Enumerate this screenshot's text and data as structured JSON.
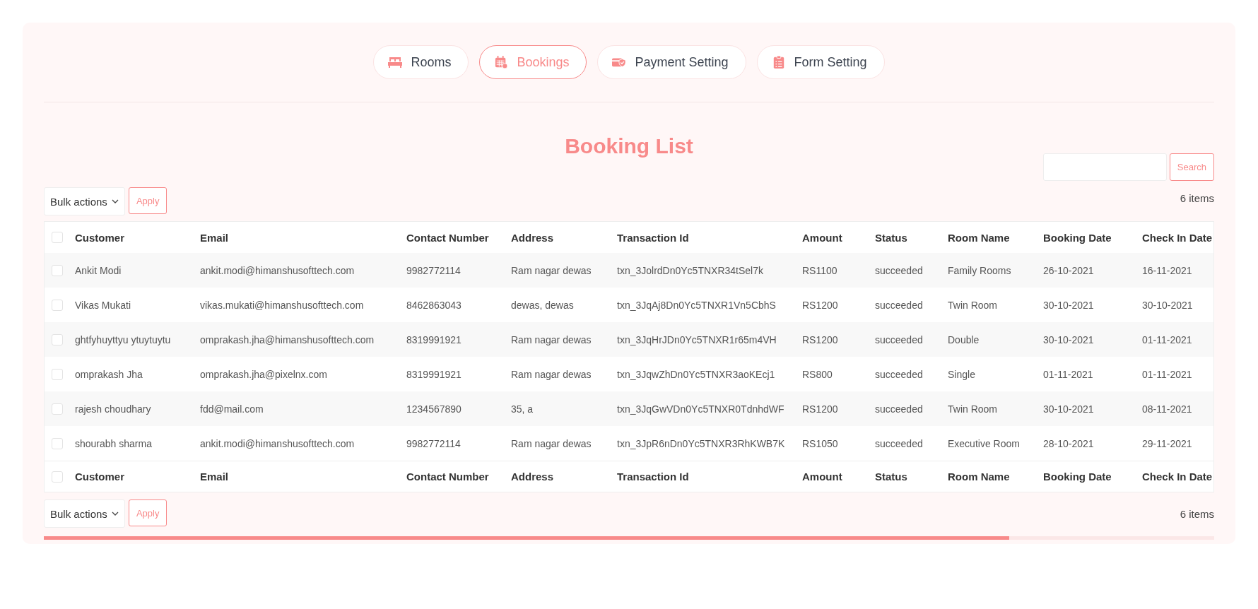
{
  "tabs": [
    {
      "label": "Rooms",
      "selected": false
    },
    {
      "label": "Bookings",
      "selected": true
    },
    {
      "label": "Payment Setting",
      "selected": false
    },
    {
      "label": "Form Setting",
      "selected": false
    }
  ],
  "title": "Booking List",
  "search": {
    "button": "Search"
  },
  "top_actions": {
    "bulk": "Bulk actions",
    "apply": "Apply",
    "count": "6 items"
  },
  "table": {
    "header_checked": false,
    "columns": [
      "Customer",
      "Email",
      "Contact Number",
      "Address",
      "Transaction Id",
      "Amount",
      "Status",
      "Room Name",
      "Booking Date",
      "Check In Date"
    ],
    "rows": [
      {
        "checked": false,
        "cells": [
          "Ankit Modi",
          "ankit.modi@himanshusofttech.com",
          "9982772114",
          "Ram nagar dewas",
          "txn_3JolrdDn0Yc5TNXR34tSel7k",
          "RS1100",
          "succeeded",
          "Family Rooms",
          "26-10-2021",
          "16-11-2021"
        ]
      },
      {
        "checked": false,
        "cells": [
          "Vikas Mukati",
          "vikas.mukati@himanshusofttech.com",
          "8462863043",
          "dewas, dewas",
          "txn_3JqAj8Dn0Yc5TNXR1Vn5CbhS",
          "RS1200",
          "succeeded",
          "Twin Room",
          "30-10-2021",
          "30-10-2021"
        ]
      },
      {
        "checked": false,
        "cells": [
          "ghtfyhuyttyu ytuytuytu",
          "omprakash.jha@himanshusofttech.com",
          "8319991921",
          "Ram nagar dewas",
          "txn_3JqHrJDn0Yc5TNXR1r65m4VH",
          "RS1200",
          "succeeded",
          "Double",
          "30-10-2021",
          "01-11-2021"
        ]
      },
      {
        "checked": false,
        "cells": [
          "omprakash Jha",
          "omprakash.jha@pixelnx.com",
          "8319991921",
          "Ram nagar dewas",
          "txn_3JqwZhDn0Yc5TNXR3aoKEcj1",
          "RS800",
          "succeeded",
          "Single",
          "01-11-2021",
          "01-11-2021"
        ]
      },
      {
        "checked": false,
        "cells": [
          "rajesh choudhary",
          "fdd@mail.com",
          "1234567890",
          "35, a",
          "txn_3JqGwVDn0Yc5TNXR0TdnhdWF",
          "RS1200",
          "succeeded",
          "Twin Room",
          "30-10-2021",
          "08-11-2021"
        ]
      },
      {
        "checked": false,
        "cells": [
          "shourabh sharma",
          "ankit.modi@himanshusofttech.com",
          "9982772114",
          "Ram nagar dewas",
          "txn_3JpR6nDn0Yc5TNXR3RhKWB7K",
          "RS1050",
          "succeeded",
          "Executive Room",
          "28-10-2021",
          "29-11-2021"
        ]
      }
    ],
    "footer_checked": false,
    "footer_columns": [
      "Customer",
      "Email",
      "Contact Number",
      "Address",
      "Transaction Id",
      "Amount",
      "Status",
      "Room Name",
      "Booking Date",
      "Check In Date"
    ]
  },
  "bottom_actions": {
    "bulk": "Bulk actions",
    "apply": "Apply",
    "count": "6 items"
  }
}
